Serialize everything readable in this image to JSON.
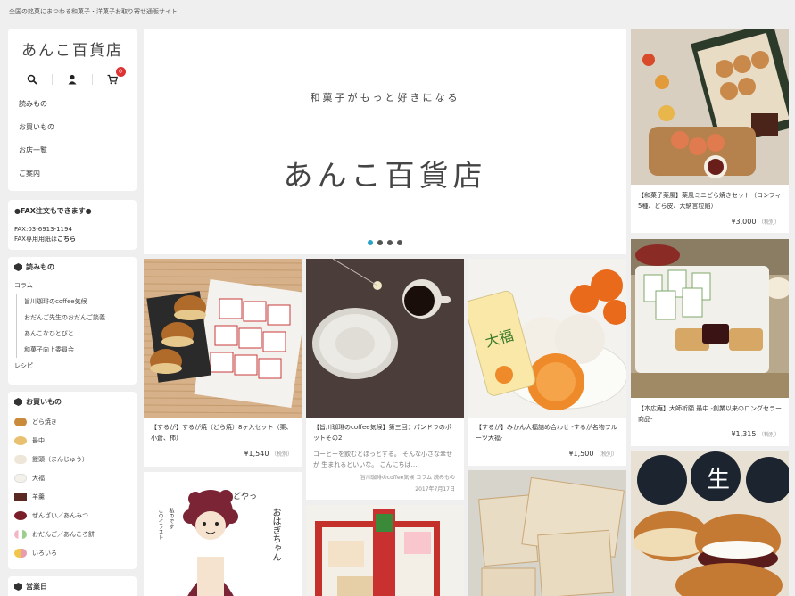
{
  "header": {
    "tagline": "全国の銘菓にまつわる和菓子・洋菓子お取り寄せ通販サイト"
  },
  "sidebar": {
    "logo": "あんこ百貨店",
    "cart_count": "0",
    "nav": [
      "読みもの",
      "お買いもの",
      "お店一覧",
      "ご案内"
    ],
    "fax": {
      "title": "●FAX注文もできます●",
      "line1": "FAX:03-6913-1194",
      "line2": "FAX専用用紙は",
      "link": "こちら"
    },
    "reading": {
      "title": "読みもの",
      "column": "コラム",
      "items": [
        "旨川珈琲のcoffee気候",
        "おだんご先生のおだんご談義",
        "あんこなひとびと",
        "和菓子向上委員会"
      ],
      "recipe": "レシピ"
    },
    "shopping": {
      "title": "お買いもの",
      "items": [
        "どら焼き",
        "最中",
        "饅頭（まんじゅう）",
        "大福",
        "羊羹",
        "ぜんざい／あんみつ",
        "おだんご／あんころ餅",
        "いろいろ"
      ]
    },
    "hours_title": "営業日"
  },
  "hero": {
    "subtitle": "和菓子がもっと好きになる",
    "title": "あんこ百貨店"
  },
  "products": [
    {
      "title": "【和菓子薬風】薬風ミニどら焼きセット（コンフィ5種、どら皮、大納言粒餡）",
      "price": "¥3,000",
      "tax": "（税別）"
    },
    {
      "title": "【するが】するが焼（どら焼）8ヶ入セット（栗、小倉、柿）",
      "price": "¥1,540",
      "tax": "（税別）"
    },
    {
      "title": "【旨川珈琲のcoffee気候】第三回：パンドラのポットその2",
      "desc": "コーヒーを飲むとほっとする。 そんな小さな幸せが 生まれるといいな。 こんにちは…",
      "author": "旨川珈琲のcoffee気候 コラム 読みもの",
      "date": "2017年7月17日"
    },
    {
      "title": "【するが】みかん大福詰め合わせ -するが名物フルーツ大福-",
      "price": "¥1,500",
      "tax": "（税別）"
    },
    {
      "title": "【本広庵】大師祈願 最中 -創業以来のロングセラー商品-",
      "price": "¥1,315",
      "tax": "（税別）"
    }
  ],
  "illustration": {
    "line1": "どやっ",
    "line2": "おはぎちゃん",
    "line3": "このイラスト",
    "line4": "私のです"
  },
  "colors": {
    "accent": "#29a3c9",
    "badge": "#d33333"
  }
}
